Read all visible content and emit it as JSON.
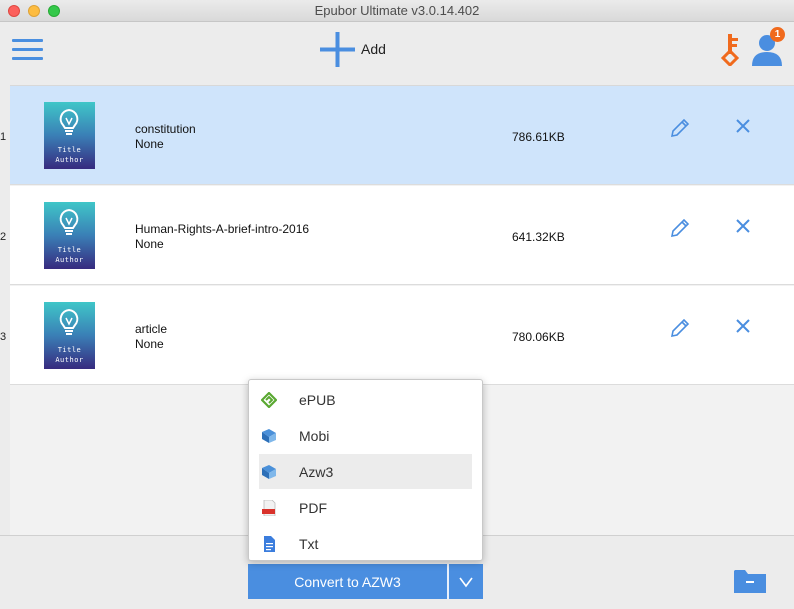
{
  "window": {
    "title": "Epubor Ultimate v3.0.14.402"
  },
  "toolbar": {
    "add_label": "Add",
    "badge_count": "1"
  },
  "colors": {
    "accent": "#4a8ee0",
    "key_orange": "#f06a1d",
    "selected_row": "#cfe4fb"
  },
  "books": [
    {
      "index": "1",
      "title": "constitution",
      "author": "None",
      "size": "786.61KB",
      "cover_line1": "Title",
      "cover_line2": "Author",
      "selected": true
    },
    {
      "index": "2",
      "title": "Human-Rights-A-brief-intro-2016",
      "author": "None",
      "size": "641.32KB",
      "cover_line1": "Title",
      "cover_line2": "Author",
      "selected": false
    },
    {
      "index": "3",
      "title": "article",
      "author": "None",
      "size": "780.06KB",
      "cover_line1": "Title",
      "cover_line2": "Author",
      "selected": false
    }
  ],
  "formats": [
    {
      "label": "ePUB",
      "icon": "epub-icon",
      "highlighted": false
    },
    {
      "label": "Mobi",
      "icon": "mobi-book-icon",
      "highlighted": false
    },
    {
      "label": "Azw3",
      "icon": "azw3-book-icon",
      "highlighted": true
    },
    {
      "label": "PDF",
      "icon": "pdf-file-icon",
      "highlighted": false
    },
    {
      "label": "Txt",
      "icon": "txt-file-icon",
      "highlighted": false
    }
  ],
  "convert": {
    "label": "Convert to AZW3"
  }
}
